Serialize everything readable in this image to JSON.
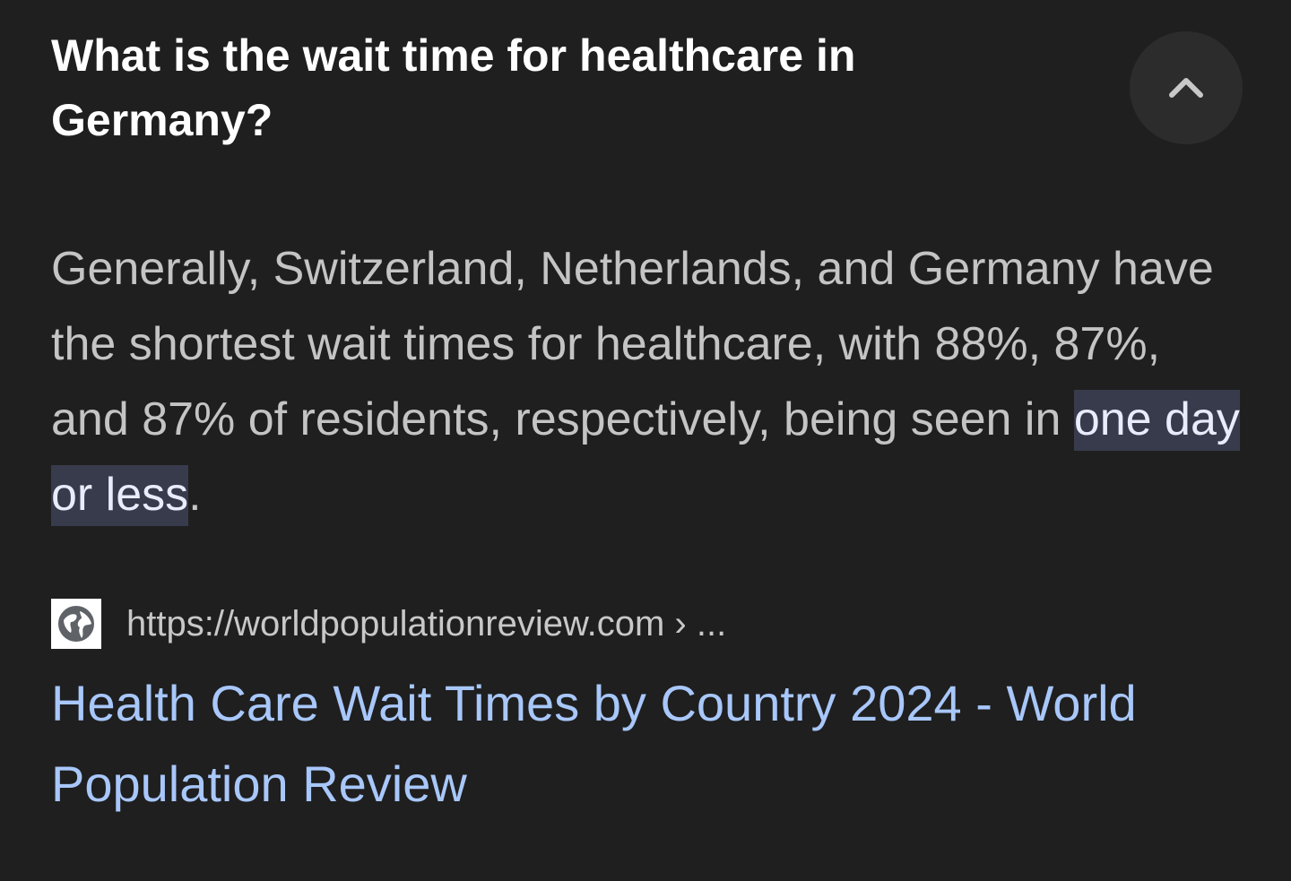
{
  "question": {
    "text": "What is the wait time for healthcare in Germany?",
    "collapse_icon": "chevron-up-icon"
  },
  "answer": {
    "before_highlight": "Generally, Switzerland, Netherlands, and Germany have the shortest wait times for healthcare, with 88%, 87%, and 87% of residents, respectively, being seen in ",
    "highlight": "one day or less",
    "after_highlight": "."
  },
  "source": {
    "favicon": "globe-icon",
    "url": "https://worldpopulationreview.com › ...",
    "title": "Health Care Wait Times by Country 2024 - World Population Review"
  },
  "colors": {
    "background": "#1f1f1f",
    "question_text": "#ffffff",
    "answer_text": "#c4c4c4",
    "highlight_background": "#373b4c",
    "link": "#a8c7fa"
  }
}
